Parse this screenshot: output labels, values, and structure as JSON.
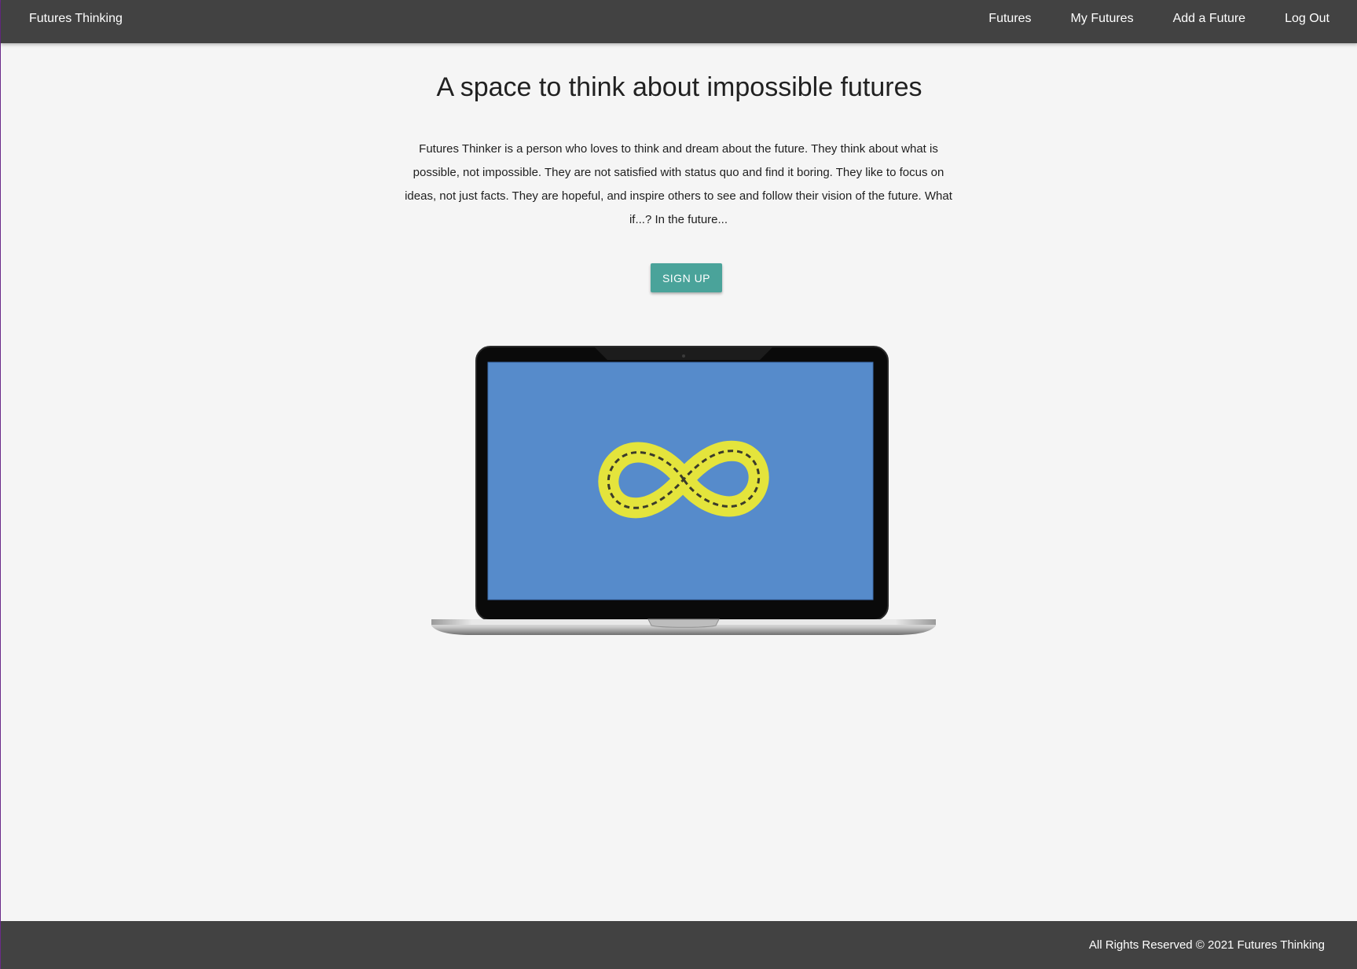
{
  "nav": {
    "brand": "Futures Thinking",
    "links": [
      {
        "label": "Futures"
      },
      {
        "label": "My Futures"
      },
      {
        "label": "Add a Future"
      },
      {
        "label": "Log Out"
      }
    ]
  },
  "hero": {
    "title": "A space to think about impossible futures",
    "description": "Futures Thinker is a person who loves to think and dream about the future. They think about what is possible, not impossible. They are not satisfied with status quo and find it boring. They like to focus on ideas, not just facts. They are hopeful, and inspire others to see and follow their vision of the future. What if...? In the future...",
    "signup_label": "SIGN UP"
  },
  "illustration": {
    "icon": "laptop-infinity-icon",
    "screen_color": "#568bcb",
    "symbol_color": "#e4e43c"
  },
  "footer": {
    "text": "All Rights Reserved © 2021 Futures Thinking"
  },
  "colors": {
    "navbar": "#424242",
    "accent": "#4aa39a",
    "background": "#f5f5f5"
  }
}
